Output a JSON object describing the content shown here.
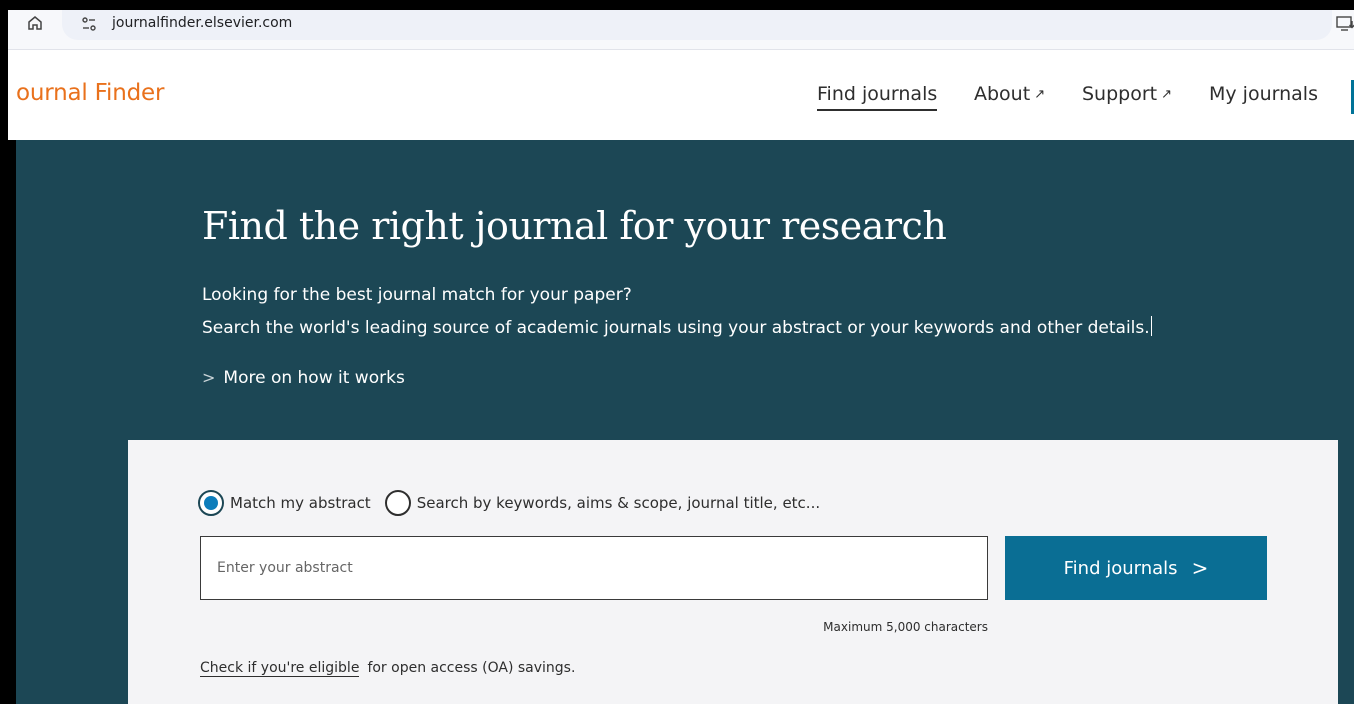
{
  "browser": {
    "url": "journalfinder.elsevier.com",
    "icons": [
      "home-icon",
      "site-settings-icon",
      "install-app-icon"
    ]
  },
  "header": {
    "logo": "ournal Finder",
    "nav": {
      "find_journals": "Find journals",
      "about": "About",
      "support": "Support",
      "my_journals": "My journals",
      "external_arrow": "↗"
    }
  },
  "hero": {
    "title": "Find the right journal for your research",
    "line1": "Looking for the best journal match for your paper?",
    "line2": "Search the world's leading source of academic journals using your abstract or your keywords and other details.",
    "more_link": "More on how it works"
  },
  "search": {
    "option_abstract": "Match my abstract",
    "option_keywords": "Search by keywords, aims & scope, journal title, etc...",
    "selected": "abstract",
    "abstract_placeholder": "Enter your abstract",
    "abstract_value": "",
    "find_button": "Find journals",
    "max_chars": "Maximum 5,000 characters",
    "oa_link": "Check if you're eligible",
    "oa_text": "for open access (OA) savings."
  },
  "colors": {
    "brand_orange": "#e9711c",
    "hero_bg": "#1c4755",
    "button_bg": "#0a6e94",
    "radio_selected": "#0c7dbb",
    "panel_bg": "#f4f4f6"
  }
}
